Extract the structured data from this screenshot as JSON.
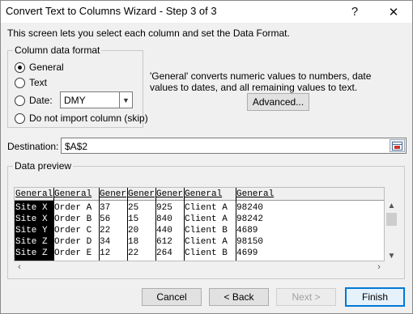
{
  "window": {
    "title": "Convert Text to Columns Wizard - Step 3 of 3",
    "help_glyph": "?",
    "close_glyph": "✕"
  },
  "intro": "This screen lets you select each column and set the Data Format.",
  "format_group": {
    "label": "Column data format",
    "options": [
      {
        "label": "General",
        "checked": true
      },
      {
        "label": "Text",
        "checked": false
      },
      {
        "label": "Date:",
        "checked": false
      },
      {
        "label": "Do not import column (skip)",
        "checked": false
      }
    ],
    "date_value": "DMY"
  },
  "description": "'General' converts numeric values to numbers, date values to dates, and all remaining values to text.",
  "advanced_button": "Advanced...",
  "destination": {
    "label": "Destination:",
    "value": "$A$2"
  },
  "preview": {
    "label": "Data preview",
    "headers": [
      "General",
      "General",
      "Gener",
      "Gener",
      "Gener",
      "General",
      "General"
    ],
    "rows": [
      [
        "Site X",
        "Order A",
        "37",
        "25",
        "925",
        "Client A",
        "98240"
      ],
      [
        "Site X",
        "Order B",
        "56",
        "15",
        "840",
        "Client A",
        "98242"
      ],
      [
        "Site Y",
        "Order C",
        "22",
        "20",
        "440",
        "Client B",
        "4689"
      ],
      [
        "Site Z",
        "Order D",
        "34",
        "18",
        "612",
        "Client A",
        "98150"
      ],
      [
        "Site Z",
        "Order E",
        "12",
        "22",
        "264",
        "Client B",
        "4699"
      ]
    ]
  },
  "buttons": {
    "cancel": "Cancel",
    "back": "< Back",
    "next": "Next >",
    "finish": "Finish"
  },
  "colors": {
    "accent": "#0078d7",
    "dialog_bg": "#f0f0f0"
  }
}
